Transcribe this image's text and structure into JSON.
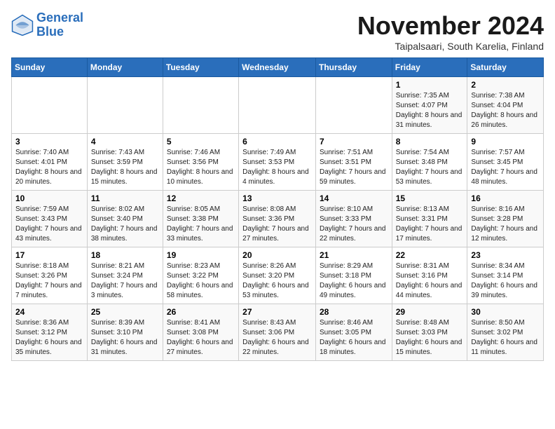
{
  "logo": {
    "line1": "General",
    "line2": "Blue"
  },
  "title": "November 2024",
  "location": "Taipalsaari, South Karelia, Finland",
  "weekdays": [
    "Sunday",
    "Monday",
    "Tuesday",
    "Wednesday",
    "Thursday",
    "Friday",
    "Saturday"
  ],
  "weeks": [
    [
      {
        "day": "",
        "sunrise": "",
        "sunset": "",
        "daylight": ""
      },
      {
        "day": "",
        "sunrise": "",
        "sunset": "",
        "daylight": ""
      },
      {
        "day": "",
        "sunrise": "",
        "sunset": "",
        "daylight": ""
      },
      {
        "day": "",
        "sunrise": "",
        "sunset": "",
        "daylight": ""
      },
      {
        "day": "",
        "sunrise": "",
        "sunset": "",
        "daylight": ""
      },
      {
        "day": "1",
        "sunrise": "Sunrise: 7:35 AM",
        "sunset": "Sunset: 4:07 PM",
        "daylight": "Daylight: 8 hours and 31 minutes."
      },
      {
        "day": "2",
        "sunrise": "Sunrise: 7:38 AM",
        "sunset": "Sunset: 4:04 PM",
        "daylight": "Daylight: 8 hours and 26 minutes."
      }
    ],
    [
      {
        "day": "3",
        "sunrise": "Sunrise: 7:40 AM",
        "sunset": "Sunset: 4:01 PM",
        "daylight": "Daylight: 8 hours and 20 minutes."
      },
      {
        "day": "4",
        "sunrise": "Sunrise: 7:43 AM",
        "sunset": "Sunset: 3:59 PM",
        "daylight": "Daylight: 8 hours and 15 minutes."
      },
      {
        "day": "5",
        "sunrise": "Sunrise: 7:46 AM",
        "sunset": "Sunset: 3:56 PM",
        "daylight": "Daylight: 8 hours and 10 minutes."
      },
      {
        "day": "6",
        "sunrise": "Sunrise: 7:49 AM",
        "sunset": "Sunset: 3:53 PM",
        "daylight": "Daylight: 8 hours and 4 minutes."
      },
      {
        "day": "7",
        "sunrise": "Sunrise: 7:51 AM",
        "sunset": "Sunset: 3:51 PM",
        "daylight": "Daylight: 7 hours and 59 minutes."
      },
      {
        "day": "8",
        "sunrise": "Sunrise: 7:54 AM",
        "sunset": "Sunset: 3:48 PM",
        "daylight": "Daylight: 7 hours and 53 minutes."
      },
      {
        "day": "9",
        "sunrise": "Sunrise: 7:57 AM",
        "sunset": "Sunset: 3:45 PM",
        "daylight": "Daylight: 7 hours and 48 minutes."
      }
    ],
    [
      {
        "day": "10",
        "sunrise": "Sunrise: 7:59 AM",
        "sunset": "Sunset: 3:43 PM",
        "daylight": "Daylight: 7 hours and 43 minutes."
      },
      {
        "day": "11",
        "sunrise": "Sunrise: 8:02 AM",
        "sunset": "Sunset: 3:40 PM",
        "daylight": "Daylight: 7 hours and 38 minutes."
      },
      {
        "day": "12",
        "sunrise": "Sunrise: 8:05 AM",
        "sunset": "Sunset: 3:38 PM",
        "daylight": "Daylight: 7 hours and 33 minutes."
      },
      {
        "day": "13",
        "sunrise": "Sunrise: 8:08 AM",
        "sunset": "Sunset: 3:36 PM",
        "daylight": "Daylight: 7 hours and 27 minutes."
      },
      {
        "day": "14",
        "sunrise": "Sunrise: 8:10 AM",
        "sunset": "Sunset: 3:33 PM",
        "daylight": "Daylight: 7 hours and 22 minutes."
      },
      {
        "day": "15",
        "sunrise": "Sunrise: 8:13 AM",
        "sunset": "Sunset: 3:31 PM",
        "daylight": "Daylight: 7 hours and 17 minutes."
      },
      {
        "day": "16",
        "sunrise": "Sunrise: 8:16 AM",
        "sunset": "Sunset: 3:28 PM",
        "daylight": "Daylight: 7 hours and 12 minutes."
      }
    ],
    [
      {
        "day": "17",
        "sunrise": "Sunrise: 8:18 AM",
        "sunset": "Sunset: 3:26 PM",
        "daylight": "Daylight: 7 hours and 7 minutes."
      },
      {
        "day": "18",
        "sunrise": "Sunrise: 8:21 AM",
        "sunset": "Sunset: 3:24 PM",
        "daylight": "Daylight: 7 hours and 3 minutes."
      },
      {
        "day": "19",
        "sunrise": "Sunrise: 8:23 AM",
        "sunset": "Sunset: 3:22 PM",
        "daylight": "Daylight: 6 hours and 58 minutes."
      },
      {
        "day": "20",
        "sunrise": "Sunrise: 8:26 AM",
        "sunset": "Sunset: 3:20 PM",
        "daylight": "Daylight: 6 hours and 53 minutes."
      },
      {
        "day": "21",
        "sunrise": "Sunrise: 8:29 AM",
        "sunset": "Sunset: 3:18 PM",
        "daylight": "Daylight: 6 hours and 49 minutes."
      },
      {
        "day": "22",
        "sunrise": "Sunrise: 8:31 AM",
        "sunset": "Sunset: 3:16 PM",
        "daylight": "Daylight: 6 hours and 44 minutes."
      },
      {
        "day": "23",
        "sunrise": "Sunrise: 8:34 AM",
        "sunset": "Sunset: 3:14 PM",
        "daylight": "Daylight: 6 hours and 39 minutes."
      }
    ],
    [
      {
        "day": "24",
        "sunrise": "Sunrise: 8:36 AM",
        "sunset": "Sunset: 3:12 PM",
        "daylight": "Daylight: 6 hours and 35 minutes."
      },
      {
        "day": "25",
        "sunrise": "Sunrise: 8:39 AM",
        "sunset": "Sunset: 3:10 PM",
        "daylight": "Daylight: 6 hours and 31 minutes."
      },
      {
        "day": "26",
        "sunrise": "Sunrise: 8:41 AM",
        "sunset": "Sunset: 3:08 PM",
        "daylight": "Daylight: 6 hours and 27 minutes."
      },
      {
        "day": "27",
        "sunrise": "Sunrise: 8:43 AM",
        "sunset": "Sunset: 3:06 PM",
        "daylight": "Daylight: 6 hours and 22 minutes."
      },
      {
        "day": "28",
        "sunrise": "Sunrise: 8:46 AM",
        "sunset": "Sunset: 3:05 PM",
        "daylight": "Daylight: 6 hours and 18 minutes."
      },
      {
        "day": "29",
        "sunrise": "Sunrise: 8:48 AM",
        "sunset": "Sunset: 3:03 PM",
        "daylight": "Daylight: 6 hours and 15 minutes."
      },
      {
        "day": "30",
        "sunrise": "Sunrise: 8:50 AM",
        "sunset": "Sunset: 3:02 PM",
        "daylight": "Daylight: 6 hours and 11 minutes."
      }
    ]
  ]
}
